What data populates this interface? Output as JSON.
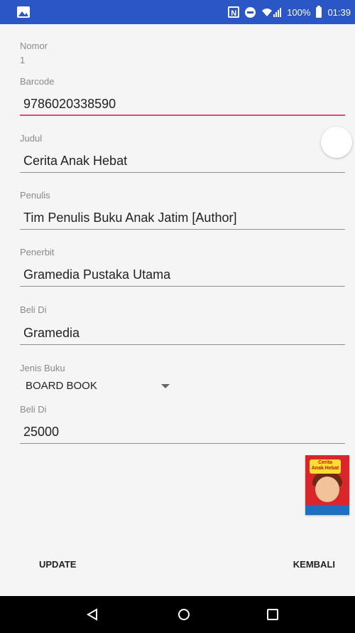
{
  "status_bar": {
    "battery_text": "100%",
    "time": "01:39",
    "left_icon": "image-icon",
    "icons": [
      "nfc-icon",
      "do-not-disturb-icon",
      "wifi-icon",
      "signal-icon",
      "battery-icon"
    ]
  },
  "form": {
    "nomor": {
      "label": "Nomor",
      "value": "1"
    },
    "barcode": {
      "label": "Barcode",
      "value": "9786020338590"
    },
    "judul": {
      "label": "Judul",
      "value": "Cerita Anak Hebat"
    },
    "penulis": {
      "label": "Penulis",
      "value": "Tim Penulis Buku Anak Jatim [Author]"
    },
    "penerbit": {
      "label": "Penerbit",
      "value": "Gramedia Pustaka Utama"
    },
    "beli_di": {
      "label": "Beli Di",
      "value": "Gramedia"
    },
    "jenis_buku": {
      "label": "Jenis Buku",
      "selected": "BOARD BOOK"
    },
    "harga": {
      "label": "Beli Di",
      "value": "25000"
    }
  },
  "cover": {
    "title_line1": "Cerita",
    "title_line2": "Anak Hebat"
  },
  "buttons": {
    "update": "UPDATE",
    "kembali": "KEMBALI"
  },
  "colors": {
    "status_bar": "#2a56c6",
    "accent": "#e0457b",
    "nav_bar": "#000000"
  }
}
